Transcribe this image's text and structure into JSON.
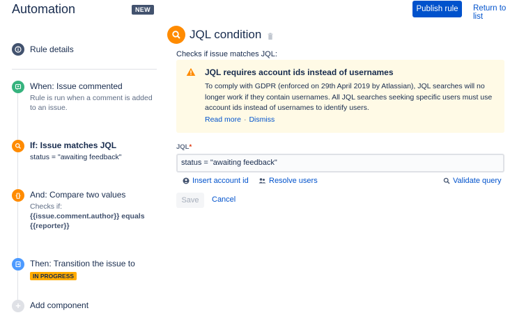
{
  "header": {
    "title": "Automation",
    "badge": "NEW",
    "publish_label": "Publish rule",
    "return_label": "Return to list"
  },
  "sidebar": {
    "rule_details": "Rule details",
    "steps": [
      {
        "title": "When: Issue commented",
        "subtitle": "Rule is run when a comment is added to an issue.",
        "icon": "comment-trigger-icon",
        "color": "#36b37e"
      },
      {
        "title": "If: Issue matches JQL",
        "subtitle": "status = \"awaiting feedback\"",
        "icon": "search-icon",
        "color": "#ff8b00"
      },
      {
        "title": "And: Compare two values",
        "subtitle": "Checks if:",
        "code": "{{issue.comment.author}} equals {{reporter}}",
        "icon": "braces-icon",
        "color": "#ff8b00"
      },
      {
        "title": "Then: Transition the issue to",
        "lozenge": "IN PROGRESS",
        "icon": "transition-icon",
        "color": "#4c9aff"
      }
    ],
    "add_component": "Add component"
  },
  "main": {
    "title": "JQL condition",
    "description": "Checks if issue matches JQL:",
    "warning": {
      "title": "JQL requires account ids instead of usernames",
      "body": "To comply with GDPR (enforced on 29th April 2019 by Atlassian), JQL searches will no longer work if they contain usernames. All JQL searches seeking specific users must use account ids instead of usernames to identify users.",
      "read_more": "Read more",
      "separator": "·",
      "dismiss": "Dismiss"
    },
    "jql_label": "JQL",
    "jql_required": "*",
    "jql_value": "status = \"awaiting feedback\"",
    "insert_account_id": "Insert account id",
    "resolve_users": "Resolve users",
    "validate_query": "Validate query",
    "save_label": "Save",
    "cancel_label": "Cancel"
  },
  "colors": {
    "primary": "#0052cc",
    "orange": "#ff8b00",
    "green": "#36b37e",
    "blue": "#4c9aff",
    "warning_bg": "#fffae6",
    "lozenge": "#ffab00"
  }
}
